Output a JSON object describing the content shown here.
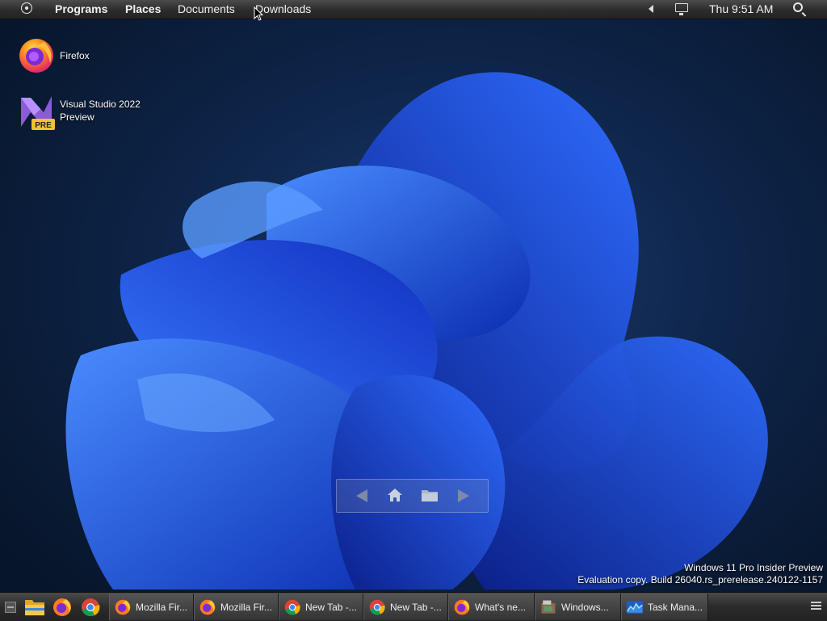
{
  "top_panel": {
    "menus": [
      "Programs",
      "Places",
      "Documents",
      "Downloads"
    ],
    "clock": "Thu 9:51 AM"
  },
  "desktop_icons": [
    {
      "label": "Firefox",
      "icon": "firefox-icon"
    },
    {
      "label": "Visual Studio 2022 Preview",
      "icon": "visual-studio-preview-icon",
      "badge": "PRE"
    }
  ],
  "watermark": {
    "line1": "Windows 11 Pro Insider Preview",
    "line2": "Evaluation copy. Build 26040.rs_prerelease.240122-1157"
  },
  "dock": {
    "items": [
      "back-arrow-icon",
      "home-icon",
      "folder-icon",
      "forward-arrow-icon"
    ]
  },
  "taskbar": {
    "launchers": [
      "show-desktop-icon",
      "file-explorer-icon",
      "firefox-icon",
      "chrome-icon"
    ],
    "windows": [
      {
        "label": "Mozilla Fir...",
        "icon": "firefox-icon"
      },
      {
        "label": "Mozilla Fir...",
        "icon": "firefox-icon"
      },
      {
        "label": "New Tab -...",
        "icon": "chrome-icon"
      },
      {
        "label": "New Tab -...",
        "icon": "chrome-icon"
      },
      {
        "label": "What's ne...",
        "icon": "firefox-icon"
      },
      {
        "label": "Windows...",
        "icon": "windows-app-icon"
      },
      {
        "label": "Task Mana...",
        "icon": "task-manager-icon"
      }
    ]
  },
  "colors": {
    "wallpaper_bg": "#0a1a30",
    "bloom_blue": "#1d4fe0",
    "panel": "#2c2c2c"
  }
}
